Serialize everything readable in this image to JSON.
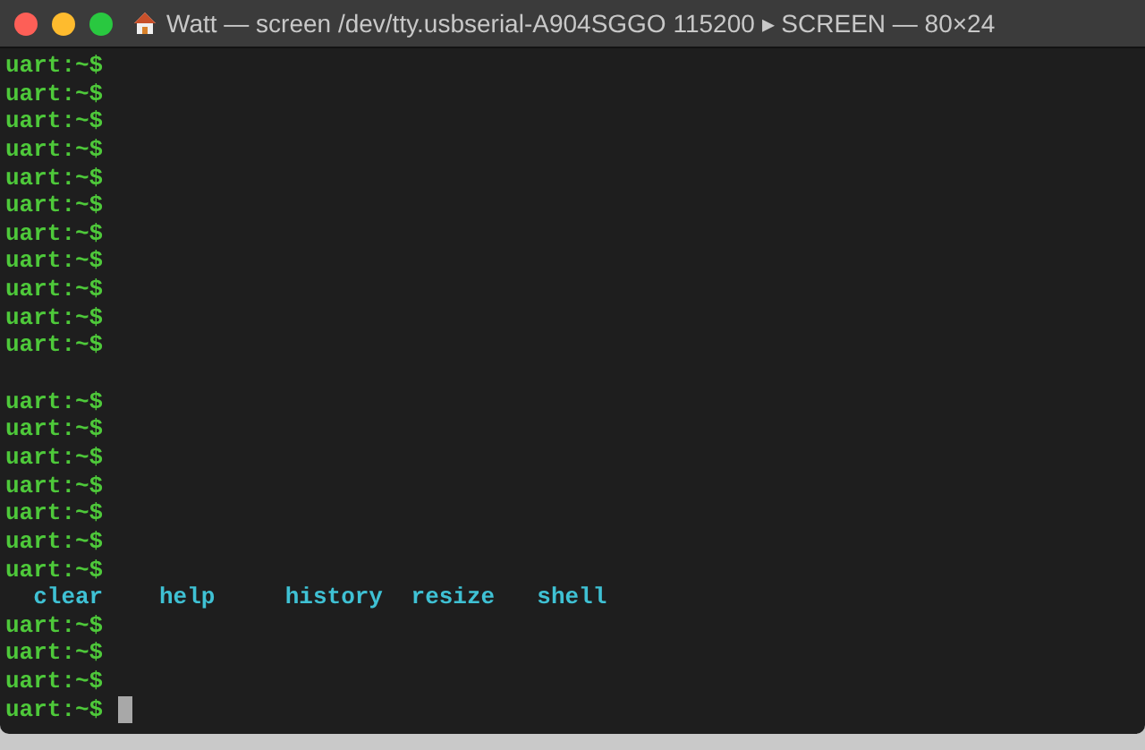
{
  "window": {
    "title": "Watt — screen /dev/tty.usbserial-A904SGGO 115200 ▸ SCREEN — 80×24"
  },
  "terminal": {
    "lines": [
      {
        "kind": "prompt",
        "text": "uart:~$"
      },
      {
        "kind": "prompt",
        "text": "uart:~$"
      },
      {
        "kind": "prompt",
        "text": "uart:~$"
      },
      {
        "kind": "prompt",
        "text": "uart:~$"
      },
      {
        "kind": "prompt",
        "text": "uart:~$"
      },
      {
        "kind": "prompt",
        "text": "uart:~$"
      },
      {
        "kind": "prompt",
        "text": "uart:~$"
      },
      {
        "kind": "prompt",
        "text": "uart:~$"
      },
      {
        "kind": "prompt",
        "text": "uart:~$"
      },
      {
        "kind": "prompt",
        "text": "uart:~$"
      },
      {
        "kind": "prompt",
        "text": "uart:~$"
      },
      {
        "kind": "blank"
      },
      {
        "kind": "prompt",
        "text": "uart:~$"
      },
      {
        "kind": "prompt",
        "text": "uart:~$"
      },
      {
        "kind": "prompt",
        "text": "uart:~$"
      },
      {
        "kind": "prompt",
        "text": "uart:~$"
      },
      {
        "kind": "prompt",
        "text": "uart:~$"
      },
      {
        "kind": "prompt",
        "text": "uart:~$"
      },
      {
        "kind": "prompt",
        "text": "uart:~$"
      },
      {
        "kind": "commands",
        "items": [
          "clear",
          "help",
          "history",
          "resize",
          "shell"
        ]
      },
      {
        "kind": "prompt",
        "text": "uart:~$"
      },
      {
        "kind": "prompt",
        "text": "uart:~$"
      },
      {
        "kind": "prompt",
        "text": "uart:~$"
      },
      {
        "kind": "prompt",
        "text": "uart:~$",
        "cursor": true
      }
    ]
  }
}
